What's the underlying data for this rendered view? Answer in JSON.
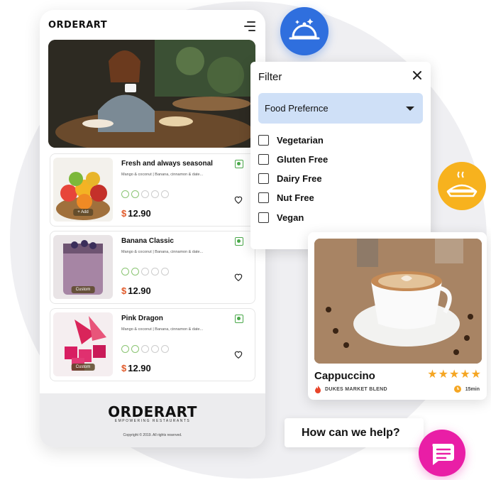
{
  "app": {
    "brand": "ORDERART",
    "tagline": "EMPOWERING RESTAURANTS",
    "copyright": "Copyright © 2019. All rights reserved."
  },
  "menu_items": [
    {
      "title": "Fresh and always seasonal",
      "desc": "Mango & coconut | Banana, cinnamon & date...",
      "price_currency": "$",
      "price": "12.90",
      "badge": "+ Add"
    },
    {
      "title": "Banana Classic",
      "desc": "Mango & coconut | Banana, cinnamon & date...",
      "price_currency": "$",
      "price": "12.90",
      "badge": "Custom"
    },
    {
      "title": "Pink Dragon",
      "desc": "Mango & coconut | Banana, cinnamon & date...",
      "price_currency": "$",
      "price": "12.90",
      "badge": "Custom"
    }
  ],
  "filter": {
    "title": "Filter",
    "dropdown_label": "Food Prefernce",
    "options": [
      {
        "label": "Vegetarian",
        "checked": false
      },
      {
        "label": "Gluten Free",
        "checked": false
      },
      {
        "label": "Dairy Free",
        "checked": false
      },
      {
        "label": "Nut Free",
        "checked": false
      },
      {
        "label": "Vegan",
        "checked": false
      }
    ]
  },
  "product": {
    "name": "Cappuccino",
    "rating": 5,
    "subtitle": "DUKES MARKET BLEND",
    "time": "15min"
  },
  "help": {
    "text": "How can we help?"
  },
  "colors": {
    "price_currency": "#e15b2b",
    "veg": "#4aa84a",
    "dish_bubble": "#2f6fde",
    "pie_bubble": "#f7b21e",
    "chat_bubble": "#e91ea6",
    "dropdown": "#cfe0f7",
    "stars": "#f5a623"
  },
  "icons": {
    "dish": "serving-dish-icon",
    "pie": "pie-icon",
    "chat": "chat-icon",
    "menu": "hamburger-menu-icon",
    "close": "close-icon",
    "heart": "heart-icon",
    "fire": "fire-icon",
    "clock": "clock-icon"
  }
}
